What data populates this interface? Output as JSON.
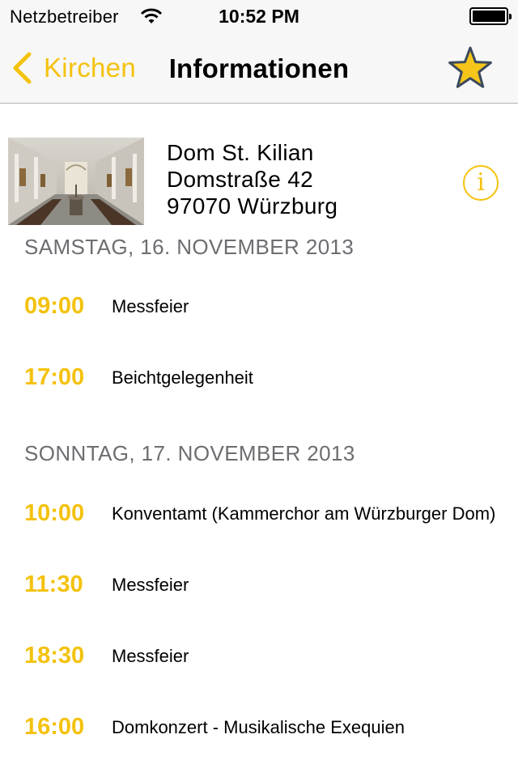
{
  "status_bar": {
    "carrier": "Netzbetreiber",
    "time": "10:52 PM"
  },
  "nav": {
    "back_label": "Kirchen",
    "title": "Informationen"
  },
  "church": {
    "name": "Dom St. Kilian",
    "street": "Domstraße 42",
    "city": "97070 Würzburg",
    "info_symbol": "i"
  },
  "days": [
    {
      "header": "SAMSTAG, 16. NOVEMBER 2013",
      "events": [
        {
          "time": "09:00",
          "title": "Messfeier"
        },
        {
          "time": "17:00",
          "title": "Beichtgelegenheit"
        }
      ]
    },
    {
      "header": "SONNTAG, 17. NOVEMBER 2013",
      "events": [
        {
          "time": "10:00",
          "title": "Konventamt (Kammerchor am Würzburger Dom)"
        },
        {
          "time": "11:30",
          "title": "Messfeier"
        },
        {
          "time": "18:30",
          "title": "Messfeier"
        },
        {
          "time": "16:00",
          "title": "Domkonzert - Musikalische Exequien"
        }
      ]
    }
  ],
  "colors": {
    "accent": "#f4c20d",
    "star_fill": "#f6c51a",
    "star_outline": "#3b4a5c",
    "section_text": "#6d6d72",
    "bar_background": "#f7f7f7"
  },
  "icons": {
    "wifi": "wifi-icon",
    "battery": "battery-icon",
    "back": "chevron-left-icon",
    "favorite": "star-icon",
    "info": "info-icon"
  }
}
